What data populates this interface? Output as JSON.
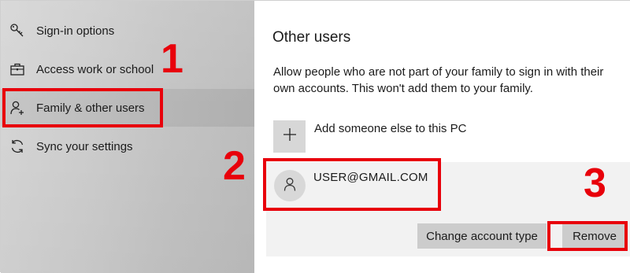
{
  "sidebar": {
    "items": [
      {
        "label": "Sign-in options",
        "icon": "key-icon"
      },
      {
        "label": "Access work or school",
        "icon": "briefcase-icon"
      },
      {
        "label": "Family & other users",
        "icon": "add-person-icon"
      },
      {
        "label": "Sync your settings",
        "icon": "sync-icon"
      }
    ]
  },
  "main": {
    "title": "Other users",
    "description": "Allow people who are not part of your family to sign in with their own accounts. This won't add them to your family.",
    "add_label": "Add someone else to this PC",
    "user": {
      "email": "USER@GMAIL.COM",
      "change_button": "Change account type",
      "remove_button": "Remove"
    }
  },
  "annotations": {
    "step1": "1",
    "step2": "2",
    "step3": "3",
    "color": "#e8000b"
  },
  "colors": {
    "sidebar_bg": "#cccccc",
    "tile_bg": "#d7d7d7",
    "panel_bg": "#f2f2f2",
    "button_bg": "#cccccc"
  }
}
